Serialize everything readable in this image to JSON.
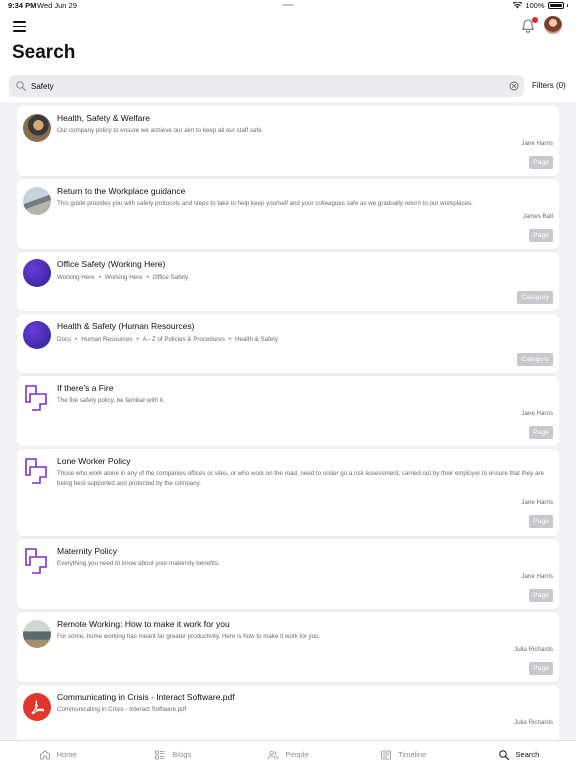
{
  "status_bar": {
    "time": "9:34 PM",
    "date": "Wed Jun 29",
    "battery": "100%"
  },
  "header": {
    "title": "Search",
    "menu_icon": "hamburger-menu-icon",
    "notification_icon": "bell-icon",
    "notification_dot_color": "#e8232b"
  },
  "search": {
    "value": "Safety",
    "placeholder": "Search",
    "filters_label": "Filters (0)"
  },
  "results": [
    {
      "title": "Health, Safety & Welfare",
      "description": "Our company policy to ensure we achieve our aim to keep all our staff safe.",
      "author": "Jane Harris",
      "type": "Page"
    },
    {
      "title": "Return to the Workplace guidance",
      "description": "This guide provides you with safety protocols and steps to take to help keep yourself and your colleagues safe as we gradually return to our workplaces.",
      "author": "James Ball",
      "type": "Page"
    },
    {
      "title": "Office Safety (Working Here)",
      "breadcrumbs": [
        "Working Here",
        "Working Here",
        "Office Safety"
      ],
      "type": "Category"
    },
    {
      "title": "Health & Safety (Human Resources)",
      "breadcrumbs": [
        "Docs",
        "Human Resources",
        "A - Z of Policies & Procedures",
        "Health & Safety"
      ],
      "type": "Category"
    },
    {
      "title": "If there's a Fire",
      "description": "The fire safety policy, be familiar with it.",
      "author": "Jane Harris",
      "type": "Page"
    },
    {
      "title": "Lone Worker Policy",
      "description": "Those who work alone in any of the companies offices or sites, or who work on the road, need to under go a risk assessment, carried out by their employer to ensure that they are being best supported and protected by the company.",
      "author": "Jane Harris",
      "type": "Page"
    },
    {
      "title": "Maternity Policy",
      "description": "Everything you need to know about your maternity benefits.",
      "author": "Jane Harris",
      "type": "Page"
    },
    {
      "title": "Remote Working: How to make it work for you",
      "description": "For some, home working has meant far greater productivity. Here is how to make it work for you.",
      "author": "Julia Richards",
      "type": "Page"
    },
    {
      "title": "Communicating in Crisis - Interact Software.pdf",
      "description": "Communicating in Crisis - Interact Software.pdf",
      "author": "Julia Richards",
      "type": ""
    }
  ],
  "tabs": [
    {
      "label": "Home",
      "icon": "home-icon"
    },
    {
      "label": "Blogs",
      "icon": "blogs-icon"
    },
    {
      "label": "People",
      "icon": "people-icon"
    },
    {
      "label": "Timeline",
      "icon": "timeline-icon"
    },
    {
      "label": "Search",
      "icon": "search-icon",
      "active": true
    }
  ],
  "colors": {
    "accent_purple": "#7b2fd0",
    "badge_gray": "#c7c7cc",
    "pdf_red": "#e0362c",
    "category_purple": "#4a2fc0"
  }
}
